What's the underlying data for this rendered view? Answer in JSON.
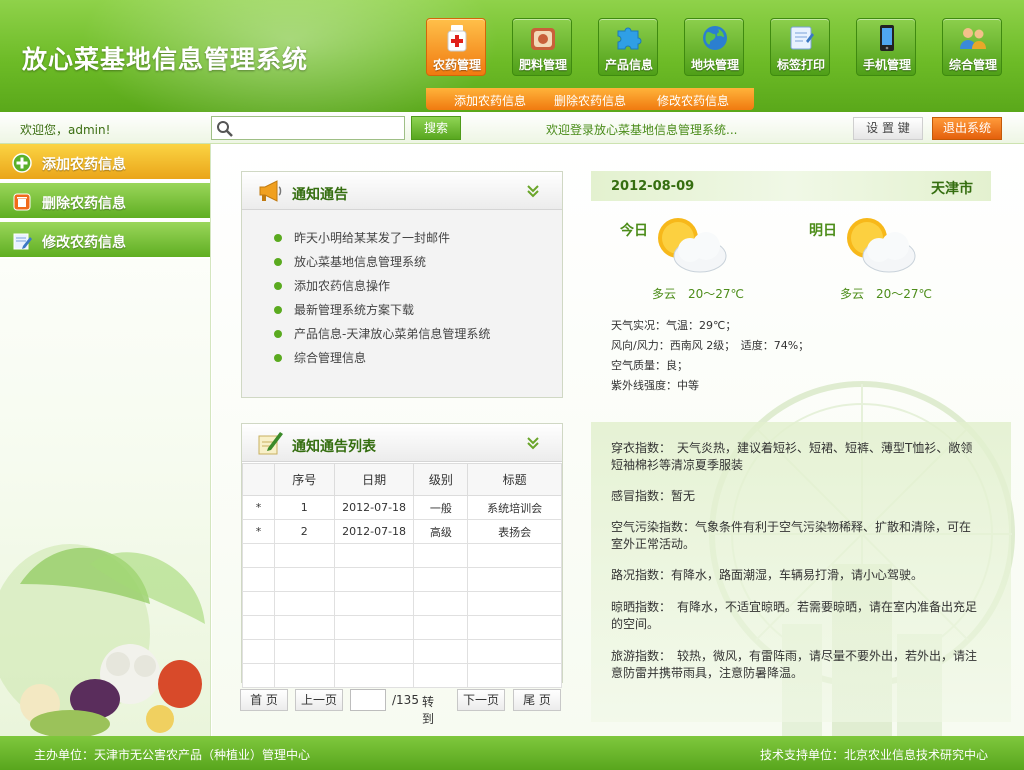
{
  "app": {
    "title": "放心菜基地信息管理系统"
  },
  "nav": {
    "items": [
      {
        "label": "农药管理",
        "icon": "pesticide-bottle-icon",
        "active": true
      },
      {
        "label": "肥料管理",
        "icon": "fertilizer-icon",
        "active": false
      },
      {
        "label": "产品信息",
        "icon": "puzzle-icon",
        "active": false
      },
      {
        "label": "地块管理",
        "icon": "globe-icon",
        "active": false
      },
      {
        "label": "标签打印",
        "icon": "label-print-icon",
        "active": false
      },
      {
        "label": "手机管理",
        "icon": "mobile-phone-icon",
        "active": false
      },
      {
        "label": "综合管理",
        "icon": "users-icon",
        "active": false
      }
    ],
    "subnav": [
      "添加农药信息",
      "删除农药信息",
      "修改农药信息"
    ]
  },
  "toolbar": {
    "welcome": "欢迎您，admin!",
    "search_placeholder": "",
    "search_label": "搜索",
    "marquee": "欢迎登录放心菜基地信息管理系统...",
    "settings_label": "设 置 键",
    "logout_label": "退出系统"
  },
  "sidebar": {
    "items": [
      {
        "label": "添加农药信息",
        "icon": "plus-circle-icon",
        "active": true
      },
      {
        "label": "删除农药信息",
        "icon": "trash-icon",
        "active": false
      },
      {
        "label": "修改农药信息",
        "icon": "edit-icon",
        "active": false
      }
    ]
  },
  "notice": {
    "title": "通知通告",
    "items": [
      "昨天小明给某某发了一封邮件",
      "放心菜基地信息管理系统",
      "添加农药信息操作",
      "最新管理系统方案下载",
      "产品信息-天津放心菜弟信息管理系统",
      "综合管理信息"
    ]
  },
  "notice_list": {
    "title": "通知通告列表",
    "columns": [
      "",
      "序号",
      "日期",
      "级别",
      "标题"
    ],
    "rows": [
      [
        "*",
        "1",
        "2012-07-18",
        "一般",
        "系统培训会"
      ],
      [
        "*",
        "2",
        "2012-07-18",
        "高级",
        "表扬会"
      ],
      [
        "",
        "",
        "",
        "",
        ""
      ],
      [
        "",
        "",
        "",
        "",
        ""
      ],
      [
        "",
        "",
        "",
        "",
        ""
      ],
      [
        "",
        "",
        "",
        "",
        ""
      ],
      [
        "",
        "",
        "",
        "",
        ""
      ],
      [
        "",
        "",
        "",
        "",
        ""
      ]
    ],
    "pager": {
      "first": "首 页",
      "prev": "上一页",
      "page_value": "",
      "total": "/135",
      "goto": "转到",
      "next": "下一页",
      "last": "尾 页"
    }
  },
  "weather": {
    "date": "2012-08-09",
    "city": "天津市",
    "today": {
      "label": "今日",
      "condition": "多云　20～27℃"
    },
    "tomorrow": {
      "label": "明日",
      "condition": "多云　20～27℃"
    },
    "details": [
      "天气实况：气温：29℃；",
      "风向/风力：西南风 2级；　适度：74%；",
      "空气质量：良；",
      "紫外线强度：中等"
    ],
    "indices": [
      "穿衣指数：　天气炎热，建议着短衫、短裙、短裤、薄型T恤衫、敞领短袖棉衫等清凉夏季服装",
      "感冒指数：暂无",
      "空气污染指数：气象条件有利于空气污染物稀释、扩散和清除，可在室外正常活动。",
      "路况指数：有降水，路面潮湿，车辆易打滑，请小心驾驶。",
      "晾晒指数：　有降水，不适宜晾晒。若需要晾晒，请在室内准备出充足的空间。",
      "旅游指数：　较热，微风，有雷阵雨，请尽量不要外出，若外出，请注意防雷并携带雨具，注意防暑降温。"
    ]
  },
  "footer": {
    "host": "主办单位：天津市无公害农产品（种植业）管理中心",
    "support": "技术支持单位：北京农业信息技术研究中心"
  },
  "colors": {
    "brand_green": "#5aa81a",
    "accent_orange": "#f07a10",
    "title_green": "#356e10"
  }
}
